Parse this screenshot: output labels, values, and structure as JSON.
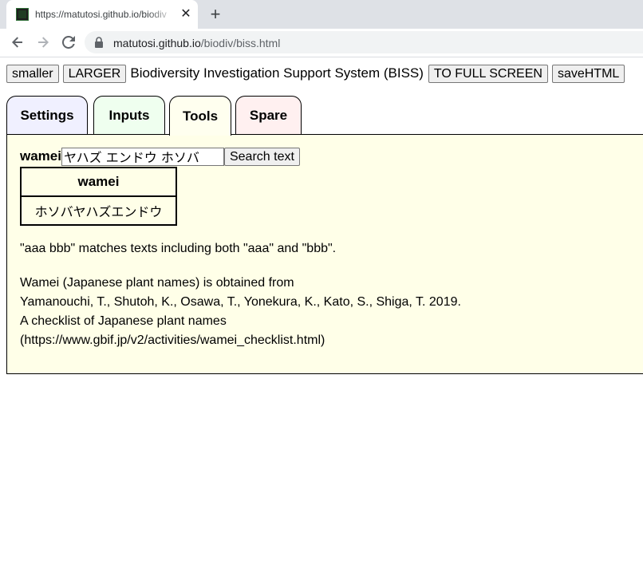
{
  "browser": {
    "tab_title": "https://matutosi.github.io/biodiv",
    "url_host": "matutosi.github.io",
    "url_path": "/biodiv/biss.html"
  },
  "topbar": {
    "smaller_label": "smaller",
    "larger_label": "LARGER",
    "app_title": "Biodiversity Investigation Support System (BISS)",
    "fullscreen_label": "TO FULL SCREEN",
    "savehtml_label": "saveHTML"
  },
  "tabs": [
    {
      "label": "Settings",
      "color": "#f0f0ff"
    },
    {
      "label": "Inputs",
      "color": "#efffef"
    },
    {
      "label": "Tools",
      "color": "#ffffef",
      "active": true
    },
    {
      "label": "Spare",
      "color": "#fff0f0"
    }
  ],
  "tools": {
    "field_label": "wamei",
    "search_value": "ヤハズ エンドウ ホソバ",
    "search_button": "Search text",
    "result_header": "wamei",
    "result_rows": [
      "ホソバヤハズエンドウ"
    ],
    "match_note": "\"aaa bbb\" matches texts including both \"aaa\" and \"bbb\".",
    "credit_lines": [
      "Wamei (Japanese plant names) is obtained from",
      "Yamanouchi, T., Shutoh, K., Osawa, T., Yonekura, K., Kato, S., Shiga, T. 2019.",
      "A checklist of Japanese plant names",
      "(https://www.gbif.jp/v2/activities/wamei_checklist.html)"
    ]
  }
}
